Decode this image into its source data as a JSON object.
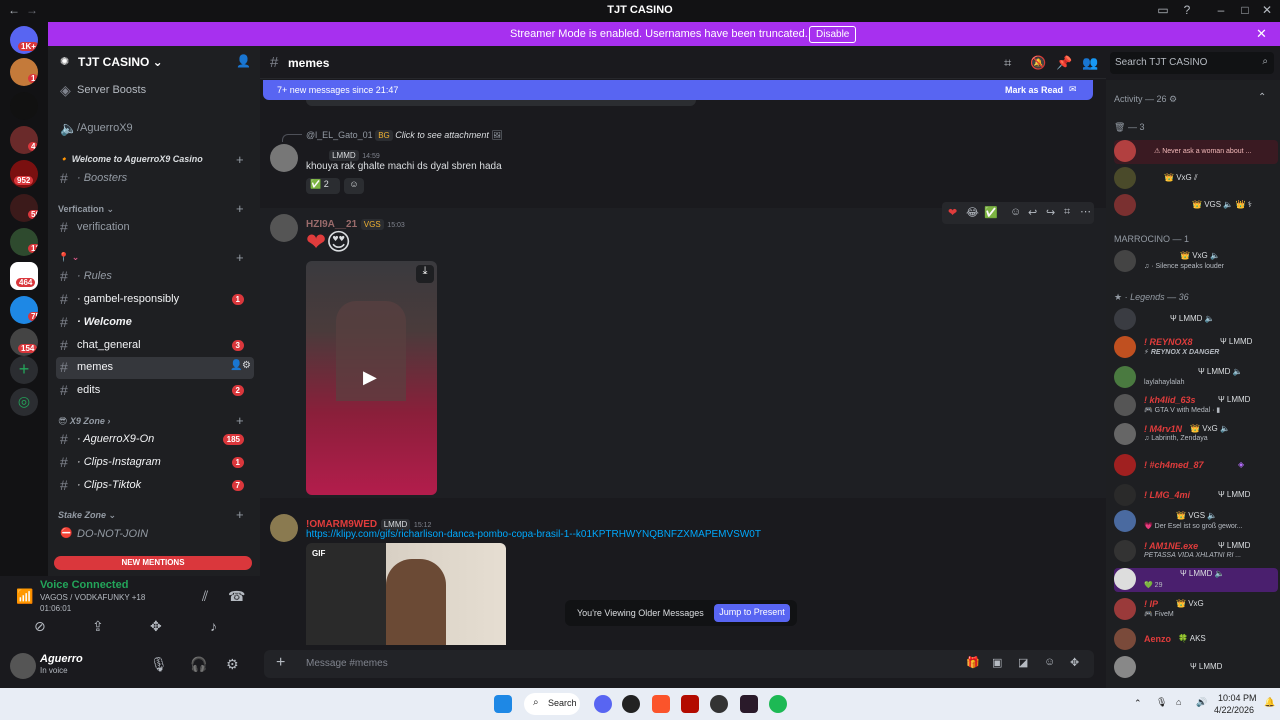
{
  "window": {
    "title": "TJT CASINO"
  },
  "banner": {
    "text": "Streamer Mode is enabled. Usernames have been truncated.",
    "disable_label": "Disable"
  },
  "rail": {
    "badges": [
      "1K+",
      "1",
      "4",
      "952",
      "56",
      "12",
      "464",
      "75",
      "154"
    ]
  },
  "sidebar": {
    "server_name": "TJT CASINO",
    "server_boosts": "Server Boosts",
    "channels": [
      {
        "name": "/AguerroX9",
        "icon": "speaker-icon"
      },
      {
        "name": "Welcome to AguerroX9 Casino",
        "type": "category"
      },
      {
        "name": "· Boosters"
      },
      {
        "name": "Verfication",
        "type": "category"
      },
      {
        "name": "verification"
      },
      {
        "name": "· Rules"
      },
      {
        "name": "· gambel-responsibly",
        "badge": "1"
      },
      {
        "name": "· Welcome"
      },
      {
        "name": "chat_general",
        "badge": "3"
      },
      {
        "name": "memes"
      },
      {
        "name": "edits",
        "badge": "2"
      },
      {
        "name": "X9 Zone",
        "type": "category"
      },
      {
        "name": "· AguerroX9-On",
        "badge": "185"
      },
      {
        "name": "· Clips-Instagram",
        "badge": "1"
      },
      {
        "name": "· Clips-Tiktok",
        "badge": "7"
      },
      {
        "name": "Stake Zone",
        "type": "category"
      },
      {
        "name": "DO-NOT-JOIN"
      }
    ],
    "new_mentions": "NEW MENTIONS"
  },
  "voice": {
    "title": "Voice Connected",
    "channel": "VAGOS / VODKAFUNKY +18",
    "time": "01:06:01"
  },
  "user": {
    "name": "Aguerro",
    "status": "In voice"
  },
  "chat": {
    "channel_name": "memes",
    "new_messages": "7+ new messages since 21:47",
    "mark_read": "Mark as Read",
    "search_placeholder": "Search TJT CASINO",
    "composer_placeholder": "Message #memes",
    "older_text": "You're Viewing Older Messages",
    "jump_label": "Jump to Present",
    "messages": [
      {
        "reply_author": "@l_EL_Gato_01",
        "reply_tag": "BG",
        "reply_text": "Click to see attachment",
        "author_tag": "LMMD",
        "time": "14:59",
        "text": "khouya rak ghalte machi ds dyal sbren hada",
        "reaction_count": "2"
      },
      {
        "author": "HZI9A__21",
        "author_tag": "VGS",
        "time": "15:03"
      },
      {
        "author": "!OMARM9WED",
        "author_tag": "LMMD",
        "time": "15:12",
        "link": "https://klipy.com/gifs/richarlison-danca-pombo-copa-brasil-1--k01KPTRHWYNQBNFZXMAPEMVSW0T",
        "gif_label": "GIF"
      }
    ]
  },
  "members": {
    "activity": "Activity — 26",
    "group1": "— 3",
    "group2": "MARROCINO — 1",
    "group3": "Legends — 36",
    "list": [
      {
        "name": "",
        "sub": "Never ask a woman about ...",
        "tag": ""
      },
      {
        "name": "",
        "sub": "",
        "tag": "VxG"
      },
      {
        "name": "",
        "sub": "",
        "tag": "VGS"
      },
      {
        "name": "",
        "sub": "Silence speaks louder",
        "tag": "VxG"
      },
      {
        "name": "",
        "sub": "",
        "tag": "LMMD"
      },
      {
        "name": "! REYNOX8",
        "sub": "REYNOX X DANGER",
        "tag": "LMMD"
      },
      {
        "name": "",
        "sub": "laylahaylalah",
        "tag": "LMMD"
      },
      {
        "name": "! kh4lid_63s",
        "sub": "GTA V with Medal",
        "tag": "LMMD"
      },
      {
        "name": "! M4rv1N",
        "sub": "Labrinth, Zendaya",
        "tag": "VxG"
      },
      {
        "name": "! #ch4med_87",
        "sub": "",
        "tag": ""
      },
      {
        "name": "! LMG_4mi",
        "sub": "",
        "tag": "LMMD"
      },
      {
        "name": "",
        "sub": "Der Esel ist so groß gewor...",
        "tag": "VGS"
      },
      {
        "name": "! AM1NE.exe",
        "sub": "PETASSA VIDA XHLATNI RI ...",
        "tag": "LMMD"
      },
      {
        "name": "",
        "sub": "29",
        "tag": "LMMD"
      },
      {
        "name": "! IP",
        "sub": "FiveM",
        "tag": "VxG"
      },
      {
        "name": "Aenzo",
        "sub": "",
        "tag": "AKS"
      },
      {
        "name": "",
        "sub": "",
        "tag": "LMMD"
      }
    ]
  },
  "taskbar": {
    "search": "Search",
    "time": "10:04 PM",
    "date": "4/22/2026"
  }
}
